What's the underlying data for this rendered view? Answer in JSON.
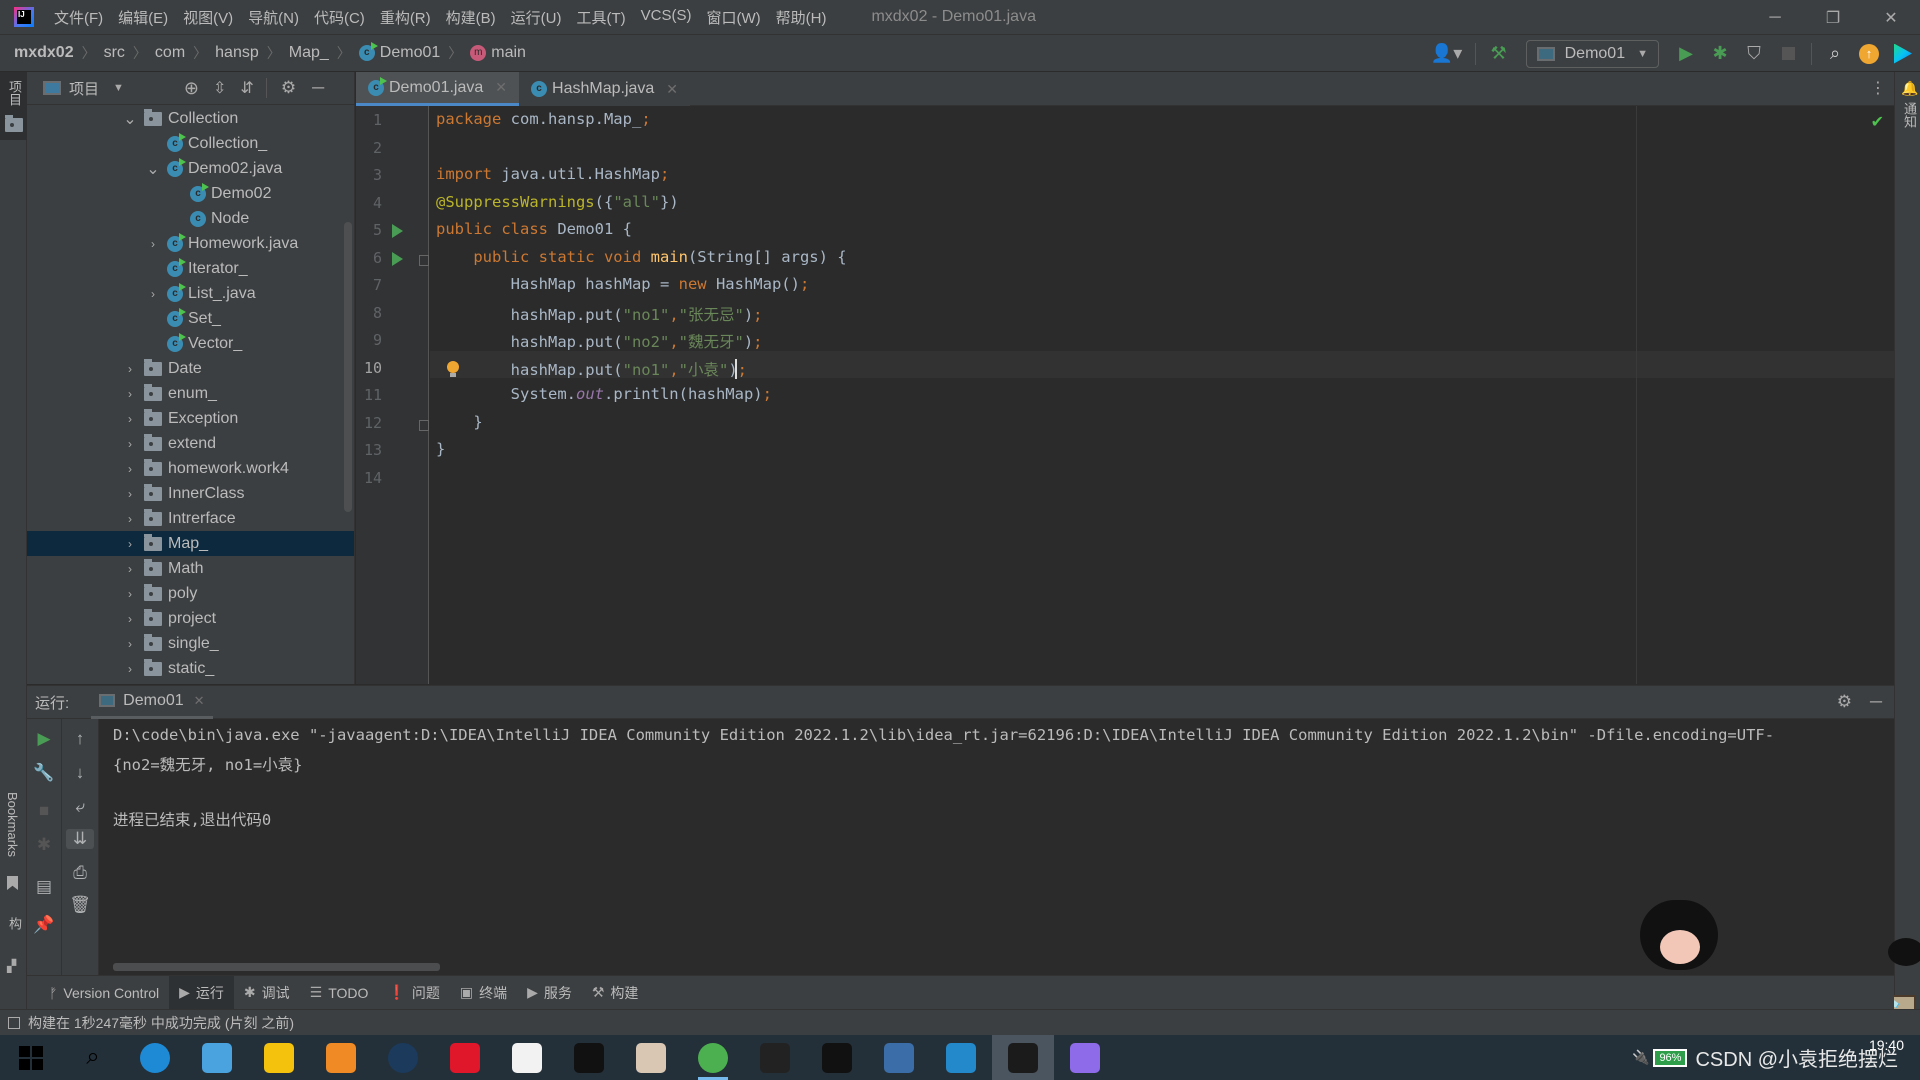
{
  "window": {
    "title": "mxdx02 - Demo01.java",
    "logo": "IJ"
  },
  "menu": [
    "文件(F)",
    "编辑(E)",
    "视图(V)",
    "导航(N)",
    "代码(C)",
    "重构(R)",
    "构建(B)",
    "运行(U)",
    "工具(T)",
    "VCS(S)",
    "窗口(W)",
    "帮助(H)"
  ],
  "window_controls": {
    "minimize": "─",
    "restore": "❐",
    "close": "✕"
  },
  "breadcrumb": [
    "mxdx02",
    "src",
    "com",
    "hansp",
    "Map_",
    "Demo01",
    "main"
  ],
  "toolbar": {
    "run_config": "Demo01",
    "icons": [
      "account-icon",
      "build-hammer-icon",
      "run-icon",
      "debug-icon",
      "coverage-icon",
      "stop-icon",
      "search-icon",
      "update-icon",
      "toolbox-icon"
    ]
  },
  "left_stripe": {
    "project_label": "项目",
    "bookmarks_label": "Bookmarks",
    "structure_label": "结构"
  },
  "right_stripe": {
    "notifications_label": "通知"
  },
  "project": {
    "header_label": "项目",
    "tree": [
      {
        "label": "Collection",
        "type": "folder",
        "depth": 0,
        "expanded": true
      },
      {
        "label": "Collection_",
        "type": "class-run",
        "depth": 1
      },
      {
        "label": "Demo02.java",
        "type": "class-run",
        "depth": 1,
        "expanded": true
      },
      {
        "label": "Demo02",
        "type": "class-run",
        "depth": 2
      },
      {
        "label": "Node",
        "type": "class",
        "depth": 2
      },
      {
        "label": "Homework.java",
        "type": "class-run",
        "depth": 1,
        "collapsed": true
      },
      {
        "label": "Iterator_",
        "type": "class-run",
        "depth": 1
      },
      {
        "label": "List_.java",
        "type": "class-run",
        "depth": 1,
        "collapsed": true
      },
      {
        "label": "Set_",
        "type": "class-run",
        "depth": 1
      },
      {
        "label": "Vector_",
        "type": "class-run",
        "depth": 1
      },
      {
        "label": "Date",
        "type": "folder",
        "depth": 0
      },
      {
        "label": "enum_",
        "type": "folder",
        "depth": 0
      },
      {
        "label": "Exception",
        "type": "folder",
        "depth": 0
      },
      {
        "label": "extend",
        "type": "folder",
        "depth": 0
      },
      {
        "label": "homework.work4",
        "type": "folder",
        "depth": 0
      },
      {
        "label": "InnerClass",
        "type": "folder",
        "depth": 0
      },
      {
        "label": "Intrerface",
        "type": "folder",
        "depth": 0
      },
      {
        "label": "Map_",
        "type": "folder",
        "depth": 0,
        "selected": true
      },
      {
        "label": "Math",
        "type": "folder",
        "depth": 0
      },
      {
        "label": "poly",
        "type": "folder",
        "depth": 0
      },
      {
        "label": "project",
        "type": "folder",
        "depth": 0
      },
      {
        "label": "single_",
        "type": "folder",
        "depth": 0
      },
      {
        "label": "static_",
        "type": "folder",
        "depth": 0
      }
    ]
  },
  "editor": {
    "tabs": [
      {
        "label": "Demo01.java",
        "active": true
      },
      {
        "label": "HashMap.java",
        "active": false
      }
    ],
    "current_line": 10,
    "lines": [
      [
        [
          "kw",
          "package "
        ],
        [
          "",
          "com.hansp.Map_"
        ],
        [
          "kw",
          ";"
        ]
      ],
      [],
      [
        [
          "kw",
          "import "
        ],
        [
          "",
          "java.util.HashMap"
        ],
        [
          "kw",
          ";"
        ]
      ],
      [
        [
          "ann",
          "@SuppressWarnings"
        ],
        [
          "",
          "({"
        ],
        [
          "str",
          "\"all\""
        ],
        [
          "",
          "})"
        ]
      ],
      [
        [
          "kw",
          "public class "
        ],
        [
          "",
          "Demo01 {"
        ]
      ],
      [
        [
          "kw",
          "    public static void "
        ],
        [
          "fn",
          "main"
        ],
        [
          "",
          "(String[] args) {"
        ]
      ],
      [
        [
          "",
          "        HashMap hashMap = "
        ],
        [
          "kw",
          "new "
        ],
        [
          "",
          "HashMap()"
        ],
        [
          "kw",
          ";"
        ]
      ],
      [
        [
          "",
          "        hashMap.put("
        ],
        [
          "str",
          "\"no1\""
        ],
        [
          "kw",
          ","
        ],
        [
          "str",
          "\"张无忌\""
        ],
        [
          "",
          ")"
        ],
        [
          "kw",
          ";"
        ]
      ],
      [
        [
          "",
          "        hashMap.put("
        ],
        [
          "str",
          "\"no2\""
        ],
        [
          "kw",
          ","
        ],
        [
          "str",
          "\"魏无牙\""
        ],
        [
          "",
          ")"
        ],
        [
          "kw",
          ";"
        ]
      ],
      [
        [
          "",
          "        hashMap.put("
        ],
        [
          "str",
          "\"no1\""
        ],
        [
          "kw",
          ","
        ],
        [
          "str",
          "\"小袁\""
        ],
        [
          "",
          ")"
        ],
        [
          "kw",
          ";"
        ]
      ],
      [
        [
          "",
          "        System."
        ],
        [
          "stat",
          "out"
        ],
        [
          "",
          ".println(hashMap)"
        ],
        [
          "kw",
          ";"
        ]
      ],
      [
        [
          "",
          "    }"
        ]
      ],
      [
        [
          "",
          "}"
        ]
      ],
      []
    ]
  },
  "run": {
    "label": "运行:",
    "tab": "Demo01",
    "console": [
      "D:\\code\\bin\\java.exe \"-javaagent:D:\\IDEA\\IntelliJ IDEA Community Edition 2022.1.2\\lib\\idea_rt.jar=62196:D:\\IDEA\\IntelliJ IDEA Community Edition 2022.1.2\\bin\" -Dfile.encoding=UTF-",
      "{no2=魏无牙, no1=小袁}",
      "",
      "进程已结束,退出代码0"
    ]
  },
  "tool_tabs": [
    {
      "label": "Version Control",
      "icon": "ᚠ"
    },
    {
      "label": "运行",
      "icon": "▶",
      "active": true
    },
    {
      "label": "调试",
      "icon": "✱"
    },
    {
      "label": "TODO",
      "icon": "☰"
    },
    {
      "label": "问题",
      "icon": "❗"
    },
    {
      "label": "终端",
      "icon": "▣"
    },
    {
      "label": "服务",
      "icon": "▶"
    },
    {
      "label": "构建",
      "icon": "⚒"
    }
  ],
  "status": {
    "message": "构建在 1秒247毫秒 中成功完成 (片刻 之前)"
  },
  "taskbar": {
    "apps": [
      {
        "name": "start",
        "color": "#000000"
      },
      {
        "name": "search",
        "color": "#000000"
      },
      {
        "name": "edge",
        "color": "#1e8ad6"
      },
      {
        "name": "computer",
        "color": "#4aa3df"
      },
      {
        "name": "tanuki-app",
        "color": "#f4c20d"
      },
      {
        "name": "everything-search",
        "color": "#f08a24"
      },
      {
        "name": "steam",
        "color": "#1b3a5c"
      },
      {
        "name": "netease-music",
        "color": "#e0162b"
      },
      {
        "name": "thunder",
        "color": "#f2f2f2"
      },
      {
        "name": "epic-games",
        "color": "#111111"
      },
      {
        "name": "anime-game",
        "color": "#d9c7b4"
      },
      {
        "name": "chrome",
        "color": "#4caf50",
        "open": true
      },
      {
        "name": "app-g",
        "color": "#222222"
      },
      {
        "name": "qq",
        "color": "#111111"
      },
      {
        "name": "dev-cpp",
        "color": "#3b6ea8"
      },
      {
        "name": "vscode",
        "color": "#2489ca"
      },
      {
        "name": "intellij",
        "color": "#1b1b1b",
        "active": true
      },
      {
        "name": "app-hex",
        "color": "#8e6be8"
      }
    ],
    "battery": "96%",
    "time": "19:40",
    "watermark": "CSDN @小袁拒绝摆烂"
  }
}
